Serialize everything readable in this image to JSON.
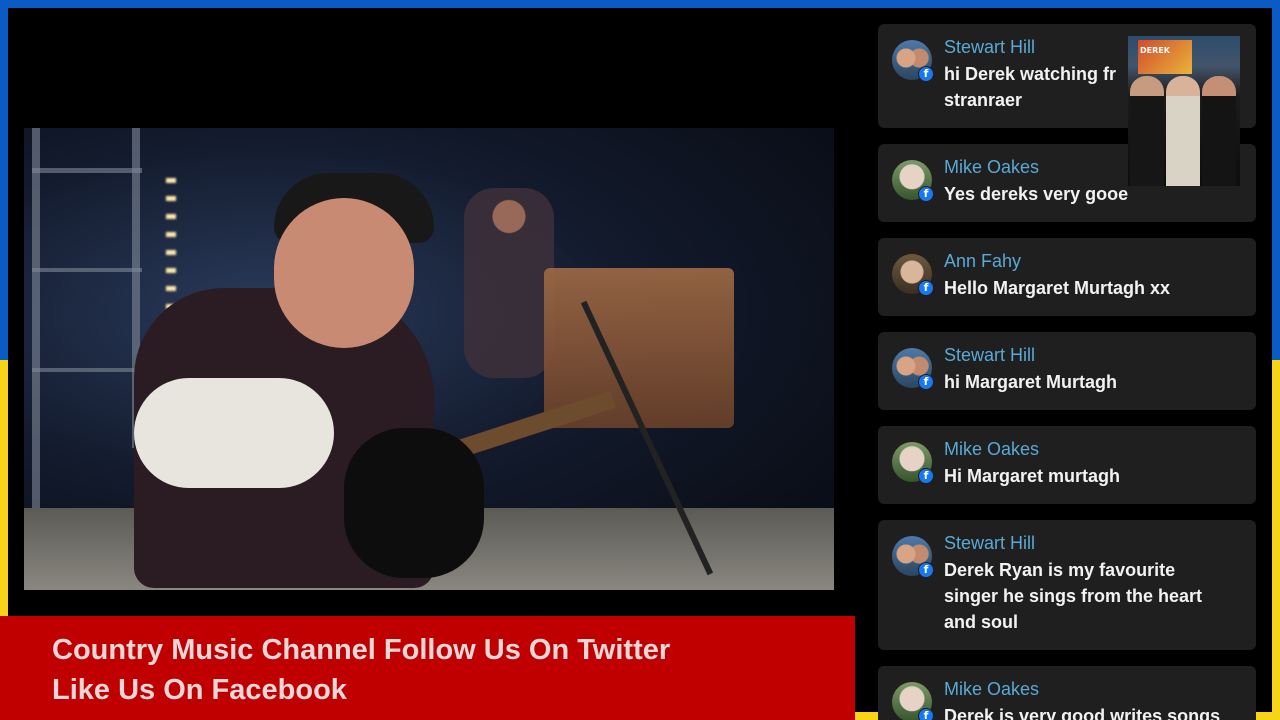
{
  "ticker": {
    "line1": "Country Music Channel Follow Us On Twitter",
    "line2": "Like Us On Facebook"
  },
  "chat": {
    "messages": [
      {
        "author": "Stewart Hill",
        "text": "hi Derek watching fr",
        "text2": "stranraer",
        "avatar": "stewart"
      },
      {
        "author": "Mike Oakes",
        "text": "Yes dereks very gooe",
        "avatar": "mike"
      },
      {
        "author": "Ann Fahy",
        "text": "Hello Margaret Murtagh xx",
        "avatar": "ann"
      },
      {
        "author": "Stewart Hill",
        "text": "hi Margaret Murtagh",
        "avatar": "stewart"
      },
      {
        "author": "Mike Oakes",
        "text": "Hi Margaret murtagh",
        "avatar": "mike"
      },
      {
        "author": "Stewart Hill",
        "text": "Derek Ryan is my favourite\nsinger he sings from the heart\nand soul",
        "avatar": "stewart"
      },
      {
        "author": "Mike Oakes",
        "text": "Derek is very good writes songs",
        "avatar": "mike"
      }
    ],
    "badge_icon": "facebook-icon",
    "badge_glyph": "f"
  },
  "poster": {
    "title": "DEREK"
  },
  "colors": {
    "frame_top": "#0a5bc4",
    "frame_bottom": "#f7d417",
    "ticker_bg": "#c00000",
    "author": "#5aa9d6"
  }
}
